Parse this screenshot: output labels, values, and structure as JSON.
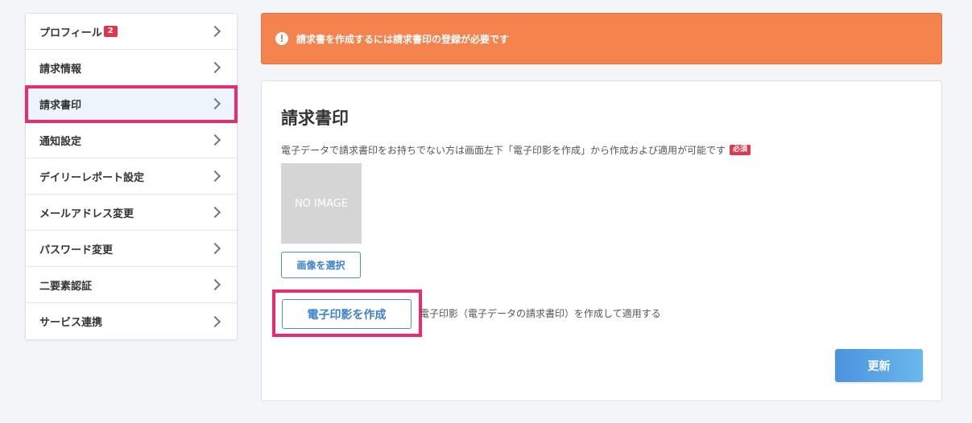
{
  "sidebar": {
    "items": [
      {
        "label": "プロフィール",
        "badge": "2"
      },
      {
        "label": "請求情報"
      },
      {
        "label": "請求書印",
        "active": true
      },
      {
        "label": "通知設定"
      },
      {
        "label": "デイリーレポート設定"
      },
      {
        "label": "メールアドレス変更"
      },
      {
        "label": "パスワード変更"
      },
      {
        "label": "二要素認証"
      },
      {
        "label": "サービス連携"
      }
    ]
  },
  "alert": {
    "icon": "exclamation-circle-icon",
    "text": "請求書を作成するには請求書印の登録が必要です",
    "color": "#f4834e"
  },
  "card": {
    "title": "請求書印",
    "description": "電子データで請求書印をお持ちでない方は画面左下「電子印影を作成」から作成および適用が可能です",
    "required_badge": "必須",
    "image_placeholder": "NO IMAGE",
    "select_image_label": "画像を選択",
    "create_seal_label": "電子印影を作成",
    "create_seal_note": "電子印影（電子データの請求書印）を作成して適用する",
    "update_label": "更新"
  },
  "colors": {
    "accent": "#4a90d9",
    "highlight": "#ec2b6c",
    "badge": "#e0384a"
  }
}
